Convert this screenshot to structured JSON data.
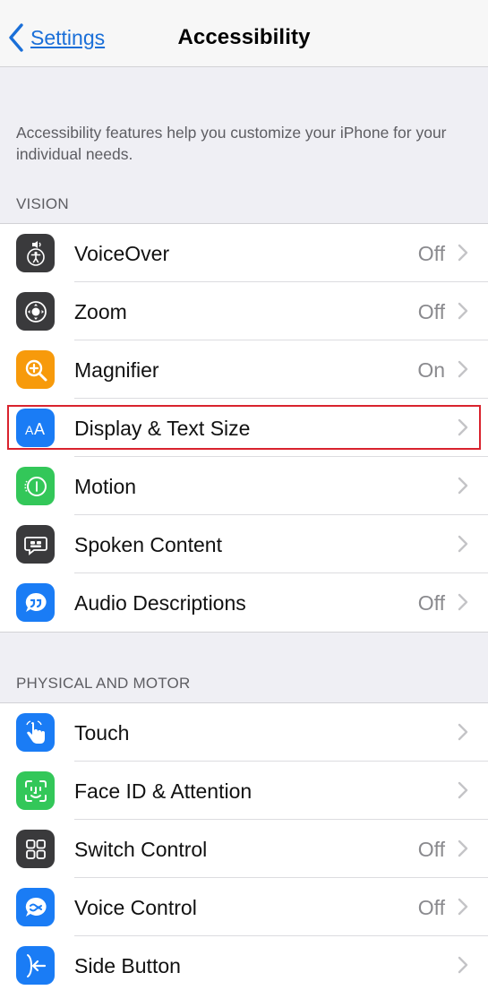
{
  "navbar": {
    "back_label": "Settings",
    "title": "Accessibility"
  },
  "intro_text": "Accessibility features help you customize your iPhone for your individual needs.",
  "sections": [
    {
      "header": "VISION",
      "items": [
        {
          "label": "VoiceOver",
          "value": "Off",
          "icon": "voiceover-icon",
          "icon_bg": "#3a3a3c"
        },
        {
          "label": "Zoom",
          "value": "Off",
          "icon": "zoom-icon",
          "icon_bg": "#3a3a3c"
        },
        {
          "label": "Magnifier",
          "value": "On",
          "icon": "magnifier-icon",
          "icon_bg": "#f79a0b"
        },
        {
          "label": "Display & Text Size",
          "value": "",
          "icon": "display-text-size-icon",
          "icon_bg": "#1a7cf5"
        },
        {
          "label": "Motion",
          "value": "",
          "icon": "motion-icon",
          "icon_bg": "#33c759"
        },
        {
          "label": "Spoken Content",
          "value": "",
          "icon": "spoken-content-icon",
          "icon_bg": "#3a3a3c"
        },
        {
          "label": "Audio Descriptions",
          "value": "Off",
          "icon": "audio-descriptions-icon",
          "icon_bg": "#1a7cf5"
        }
      ]
    },
    {
      "header": "PHYSICAL AND MOTOR",
      "items": [
        {
          "label": "Touch",
          "value": "",
          "icon": "touch-icon",
          "icon_bg": "#1a7cf5"
        },
        {
          "label": "Face ID & Attention",
          "value": "",
          "icon": "face-id-icon",
          "icon_bg": "#33c759"
        },
        {
          "label": "Switch Control",
          "value": "Off",
          "icon": "switch-control-icon",
          "icon_bg": "#3a3a3c"
        },
        {
          "label": "Voice Control",
          "value": "Off",
          "icon": "voice-control-icon",
          "icon_bg": "#1a7cf5"
        },
        {
          "label": "Side Button",
          "value": "",
          "icon": "side-button-icon",
          "icon_bg": "#1a7cf5"
        }
      ]
    }
  ],
  "colors": {
    "accent": "#1a6fd8",
    "highlight_border": "#d9232e"
  }
}
